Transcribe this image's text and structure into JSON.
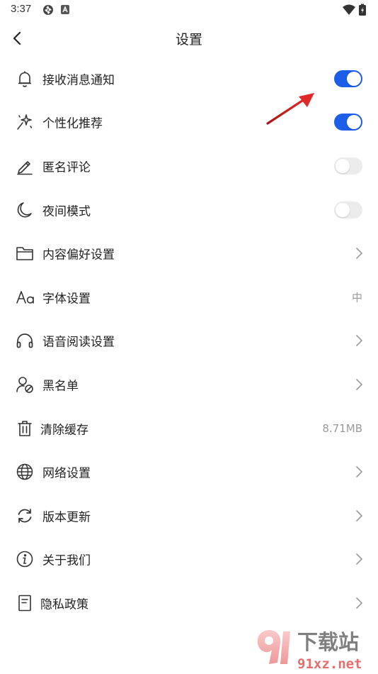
{
  "status_bar": {
    "time": "3:37"
  },
  "header": {
    "title": "设置"
  },
  "colors": {
    "accent": "#1d5ee8",
    "annotation_arrow": "#d82020"
  },
  "settings": [
    {
      "label": "接收消息通知",
      "icon": "bell-icon",
      "control": "toggle",
      "on": true
    },
    {
      "label": "个性化推荐",
      "icon": "sparkle-icon",
      "control": "toggle",
      "on": true
    },
    {
      "label": "匿名评论",
      "icon": "pencil-icon",
      "control": "toggle",
      "on": false
    },
    {
      "label": "夜间模式",
      "icon": "moon-icon",
      "control": "toggle",
      "on": false
    },
    {
      "label": "内容偏好设置",
      "icon": "folder-icon",
      "control": "chevron"
    },
    {
      "label": "字体设置",
      "icon": "font-aa-icon",
      "control": "value",
      "value": "中"
    },
    {
      "label": "语音阅读设置",
      "icon": "headphones-icon",
      "control": "chevron"
    },
    {
      "label": "黑名单",
      "icon": "user-block-icon",
      "control": "chevron"
    },
    {
      "label": "清除缓存",
      "icon": "trash-icon",
      "control": "value",
      "value": "8.71MB"
    },
    {
      "label": "网络设置",
      "icon": "globe-icon",
      "control": "chevron"
    },
    {
      "label": "版本更新",
      "icon": "refresh-icon",
      "control": "chevron"
    },
    {
      "label": "关于我们",
      "icon": "info-icon",
      "control": "chevron"
    },
    {
      "label": "隐私政策",
      "icon": "document-icon",
      "control": "chevron"
    }
  ],
  "watermark": {
    "brand": "下载站",
    "domain": "91xz.net"
  }
}
